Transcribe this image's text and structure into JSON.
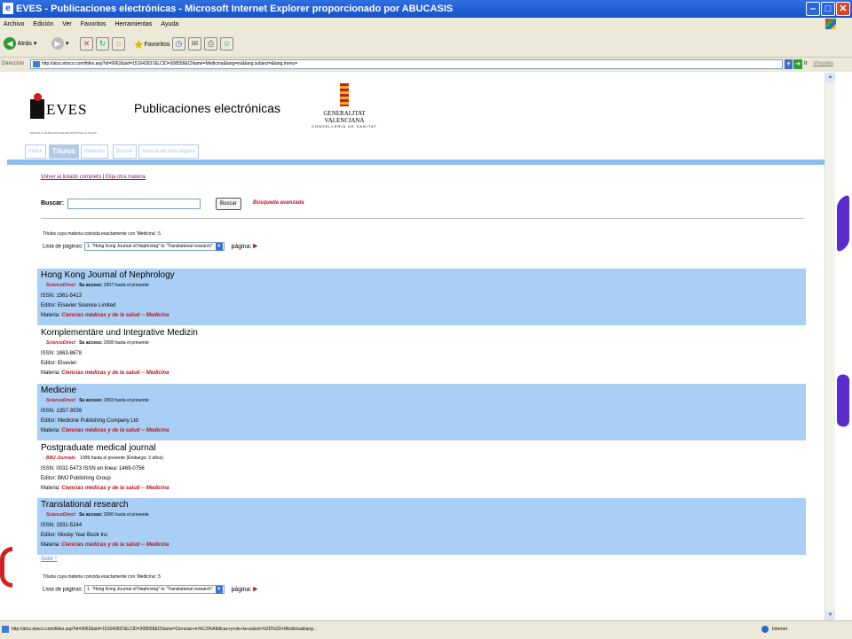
{
  "window": {
    "title": "EVES - Publicaciones electrónicas - Microsoft Internet Explorer proporcionado por ABUCASIS",
    "minimize": "–",
    "maximize": "□",
    "close": "✕"
  },
  "menu": [
    "Archivo",
    "Edición",
    "Ver",
    "Favoritos",
    "Herramientas",
    "Ayuda"
  ],
  "toolbar": {
    "back": "Atrás",
    "favorites": "Favoritos"
  },
  "address": {
    "label": "Dirección",
    "url": "http://atoz.ebsco.com/titles.asp?id=9062&sid=151642837&LCID=308558&CName=Medicina&lang=es&lang.subject=&lang.menu=",
    "go": "Ir",
    "links": "Vínculos"
  },
  "header": {
    "logo_text": "EVES",
    "logo_sub": "ESCUELA VALENCIANA DE ESTUDIOS DE LA SALUD",
    "title": "Publicaciones electrónicas",
    "gv_line1": "GENERALITAT VALENCIANA",
    "gv_line2": "CONSELLERIA DE SANITAT"
  },
  "tabs": [
    "Indice",
    "Titulos",
    "Materias",
    "Buscar",
    "Acerca de esta página"
  ],
  "nav_links": {
    "back_link": "Volver al listado completo",
    "sep": "|",
    "other_link": "Elija otra materia"
  },
  "search": {
    "label": "Buscar:",
    "value": "",
    "button": "Buscar",
    "advanced": "Búsqueda avanzada"
  },
  "count_text": "Títulos cuya materia coincida exactamente con 'Medicina': 5",
  "pagelist": {
    "label": "Lista de páginas:",
    "selected": "1. \"Hong Kong Journal of Nephrolog\" to \"Translational research\"",
    "page_label": "página:",
    "next": "▶"
  },
  "results": [
    {
      "title": "Hong Kong Journal of Nephrology",
      "provider": "ScienceDirect",
      "access_label": "Su acceso:",
      "access": "2007 hasta el presente",
      "issn": "ISSN: 1561-5413",
      "editor": "Editor: Elsevier Science Limited",
      "subject_label": "Materia:",
      "subject": "Ciencias médicas y de la salud -- Medicina"
    },
    {
      "title": "Komplementäre und Integrative Medizin",
      "provider": "ScienceDirect",
      "access_label": "Su acceso:",
      "access": "2008 hasta el presente",
      "issn": "ISSN: 1863-8678",
      "editor": "Editor: Elsevier",
      "subject_label": "Materia:",
      "subject": "Ciencias médicas y de la salud -- Medicina"
    },
    {
      "title": "Medicine",
      "provider": "ScienceDirect",
      "access_label": "Su acceso:",
      "access": "2003 hasta el presente",
      "issn": "ISSN: 1357-3039",
      "editor": "Editor: Medicine Publishing Company Ltd",
      "subject_label": "Materia:",
      "subject": "Ciencias médicas y de la salud -- Medicina"
    },
    {
      "title": "Postgraduate medical journal",
      "provider": "BMJ Journals",
      "access_label": "",
      "access": "1999 hasta el presente  (Embargo: 3 años)",
      "issn": "ISSN: 0032-5473 ISSN en línea: 1469-0756",
      "editor": "Editor: BMJ Publishing Group",
      "subject_label": "Materia:",
      "subject": "Ciencias médicas y de la salud -- Medicina"
    },
    {
      "title": "Translational research",
      "provider": "ScienceDirect",
      "access_label": "Su acceso:",
      "access": "2006 hasta el presente",
      "issn": "ISSN: 1931-5244",
      "editor": "Editor: Mosby Year Book Inc",
      "subject_label": "Materia:",
      "subject": "Ciencias médicas y de la salud -- Medicina"
    }
  ],
  "subir": "Subir ^",
  "status": {
    "url": "http://atoz.ebsco.com/titles.asp?id=9062&sid=151642837&LCID=308558&CName=Ciencias+m%C3%A9dicas+y+de+la+salud+%2D%2D+Medicina&lang...",
    "zone": "Internet"
  },
  "colors": {
    "accent": "#a9cff5",
    "title_bar": "#1652c8",
    "subject_red": "#c0101a"
  }
}
